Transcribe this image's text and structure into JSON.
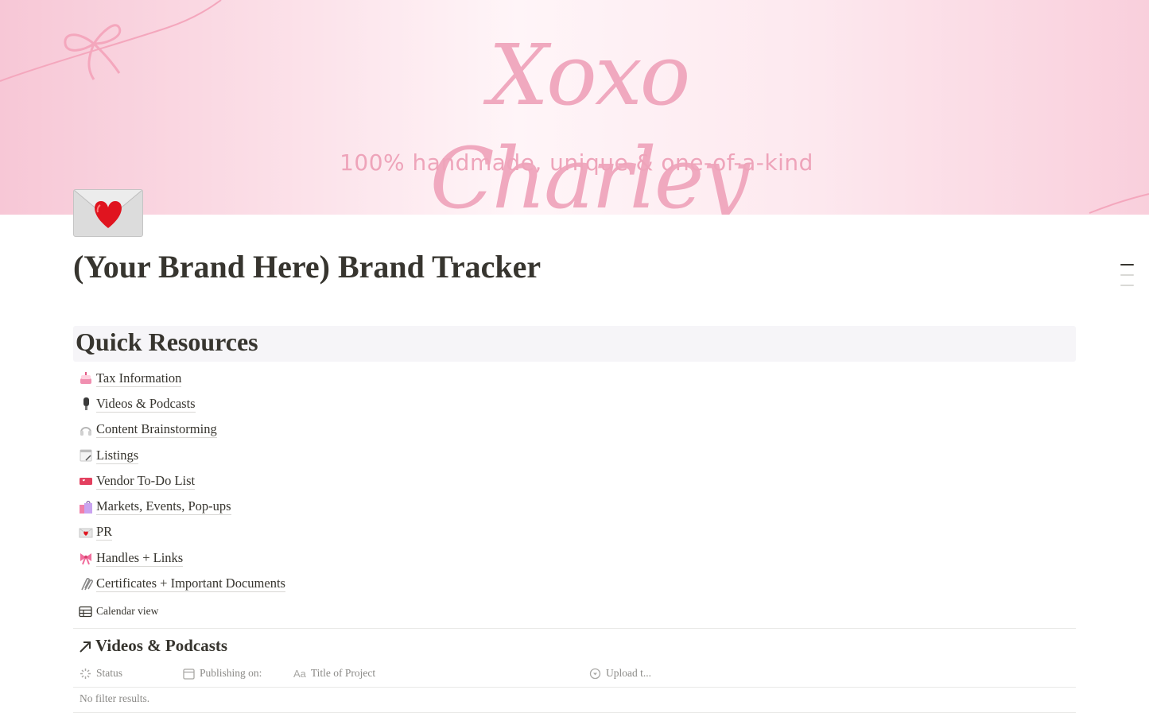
{
  "cover": {
    "brand_name": "Xoxo Charley",
    "tagline": "100% handmade, unique & one-of-a-kind"
  },
  "page": {
    "icon": "love-letter-icon",
    "title": "(Your Brand Here) Brand Tracker"
  },
  "quick_resources": {
    "heading": "Quick Resources",
    "links": [
      {
        "icon": "cake-icon",
        "label": "Tax Information"
      },
      {
        "icon": "microphone-icon",
        "label": "Videos & Podcasts"
      },
      {
        "icon": "headphones-icon",
        "label": "Content Brainstorming"
      },
      {
        "icon": "notepad-icon",
        "label": "Listings"
      },
      {
        "icon": "ticket-icon",
        "label": "Vendor To-Do List"
      },
      {
        "icon": "shopping-bags-icon",
        "label": "Markets, Events, Pop-ups"
      },
      {
        "icon": "love-letter-icon",
        "label": "PR"
      },
      {
        "icon": "ribbon-icon",
        "label": "Handles + Links"
      },
      {
        "icon": "paperclip-icon",
        "label": "Certificates + Important Documents"
      }
    ]
  },
  "database": {
    "view_label": "Calendar view",
    "title": "Videos & Podcasts",
    "columns": [
      {
        "icon": "status-icon",
        "label": "Status"
      },
      {
        "icon": "calendar-icon",
        "label": "Publishing on:"
      },
      {
        "icon": "text-icon",
        "label": "Title of Project",
        "icon_text": "Aa"
      },
      {
        "icon": "select-icon",
        "label": "Upload t..."
      }
    ],
    "empty_text": "No filter results."
  },
  "colors": {
    "accent_pink": "#f0a9bf",
    "text": "#37352f",
    "muted": "#8b8a87"
  }
}
